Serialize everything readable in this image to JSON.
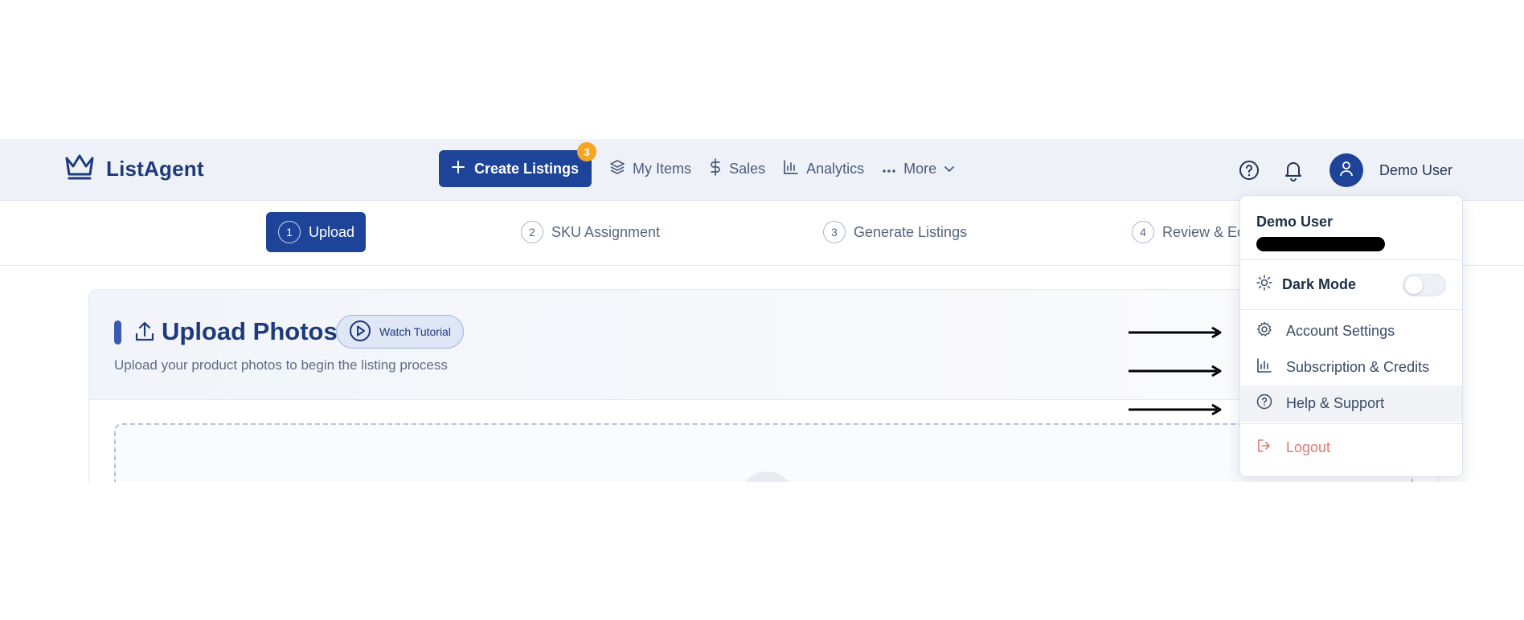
{
  "app": {
    "name": "ListAgent",
    "logo_icon": "crown-icon"
  },
  "nav": {
    "create_label": "Create Listings",
    "create_badge": "3",
    "items": [
      {
        "label": "My Items",
        "icon": "layers-icon"
      },
      {
        "label": "Sales",
        "icon": "dollar-icon"
      },
      {
        "label": "Analytics",
        "icon": "bar-chart-icon"
      },
      {
        "label": "More",
        "icon": "more-dots-icon"
      }
    ]
  },
  "user": {
    "name": "Demo User"
  },
  "steps": [
    {
      "num": "1",
      "label": "Upload",
      "active": true
    },
    {
      "num": "2",
      "label": "SKU Assignment"
    },
    {
      "num": "3",
      "label": "Generate Listings"
    },
    {
      "num": "4",
      "label": "Review & Ec"
    }
  ],
  "card": {
    "title": "Upload Photos",
    "tutorial_label": "Watch Tutorial",
    "subtitle": "Upload your product photos to begin the listing process"
  },
  "dropdown": {
    "user_name": "Demo User",
    "dark_mode_label": "Dark Mode",
    "dark_mode_on": false,
    "items": [
      {
        "label": "Account Settings",
        "icon": "gear-icon"
      },
      {
        "label": "Subscription & Credits",
        "icon": "bar-chart-icon"
      },
      {
        "label": "Help & Support",
        "icon": "help-circle-icon"
      }
    ],
    "logout_label": "Logout"
  },
  "colors": {
    "primary": "#1e4499",
    "badge": "#f5a623",
    "logout": "#e0776f",
    "title": "#1e3a7b"
  }
}
